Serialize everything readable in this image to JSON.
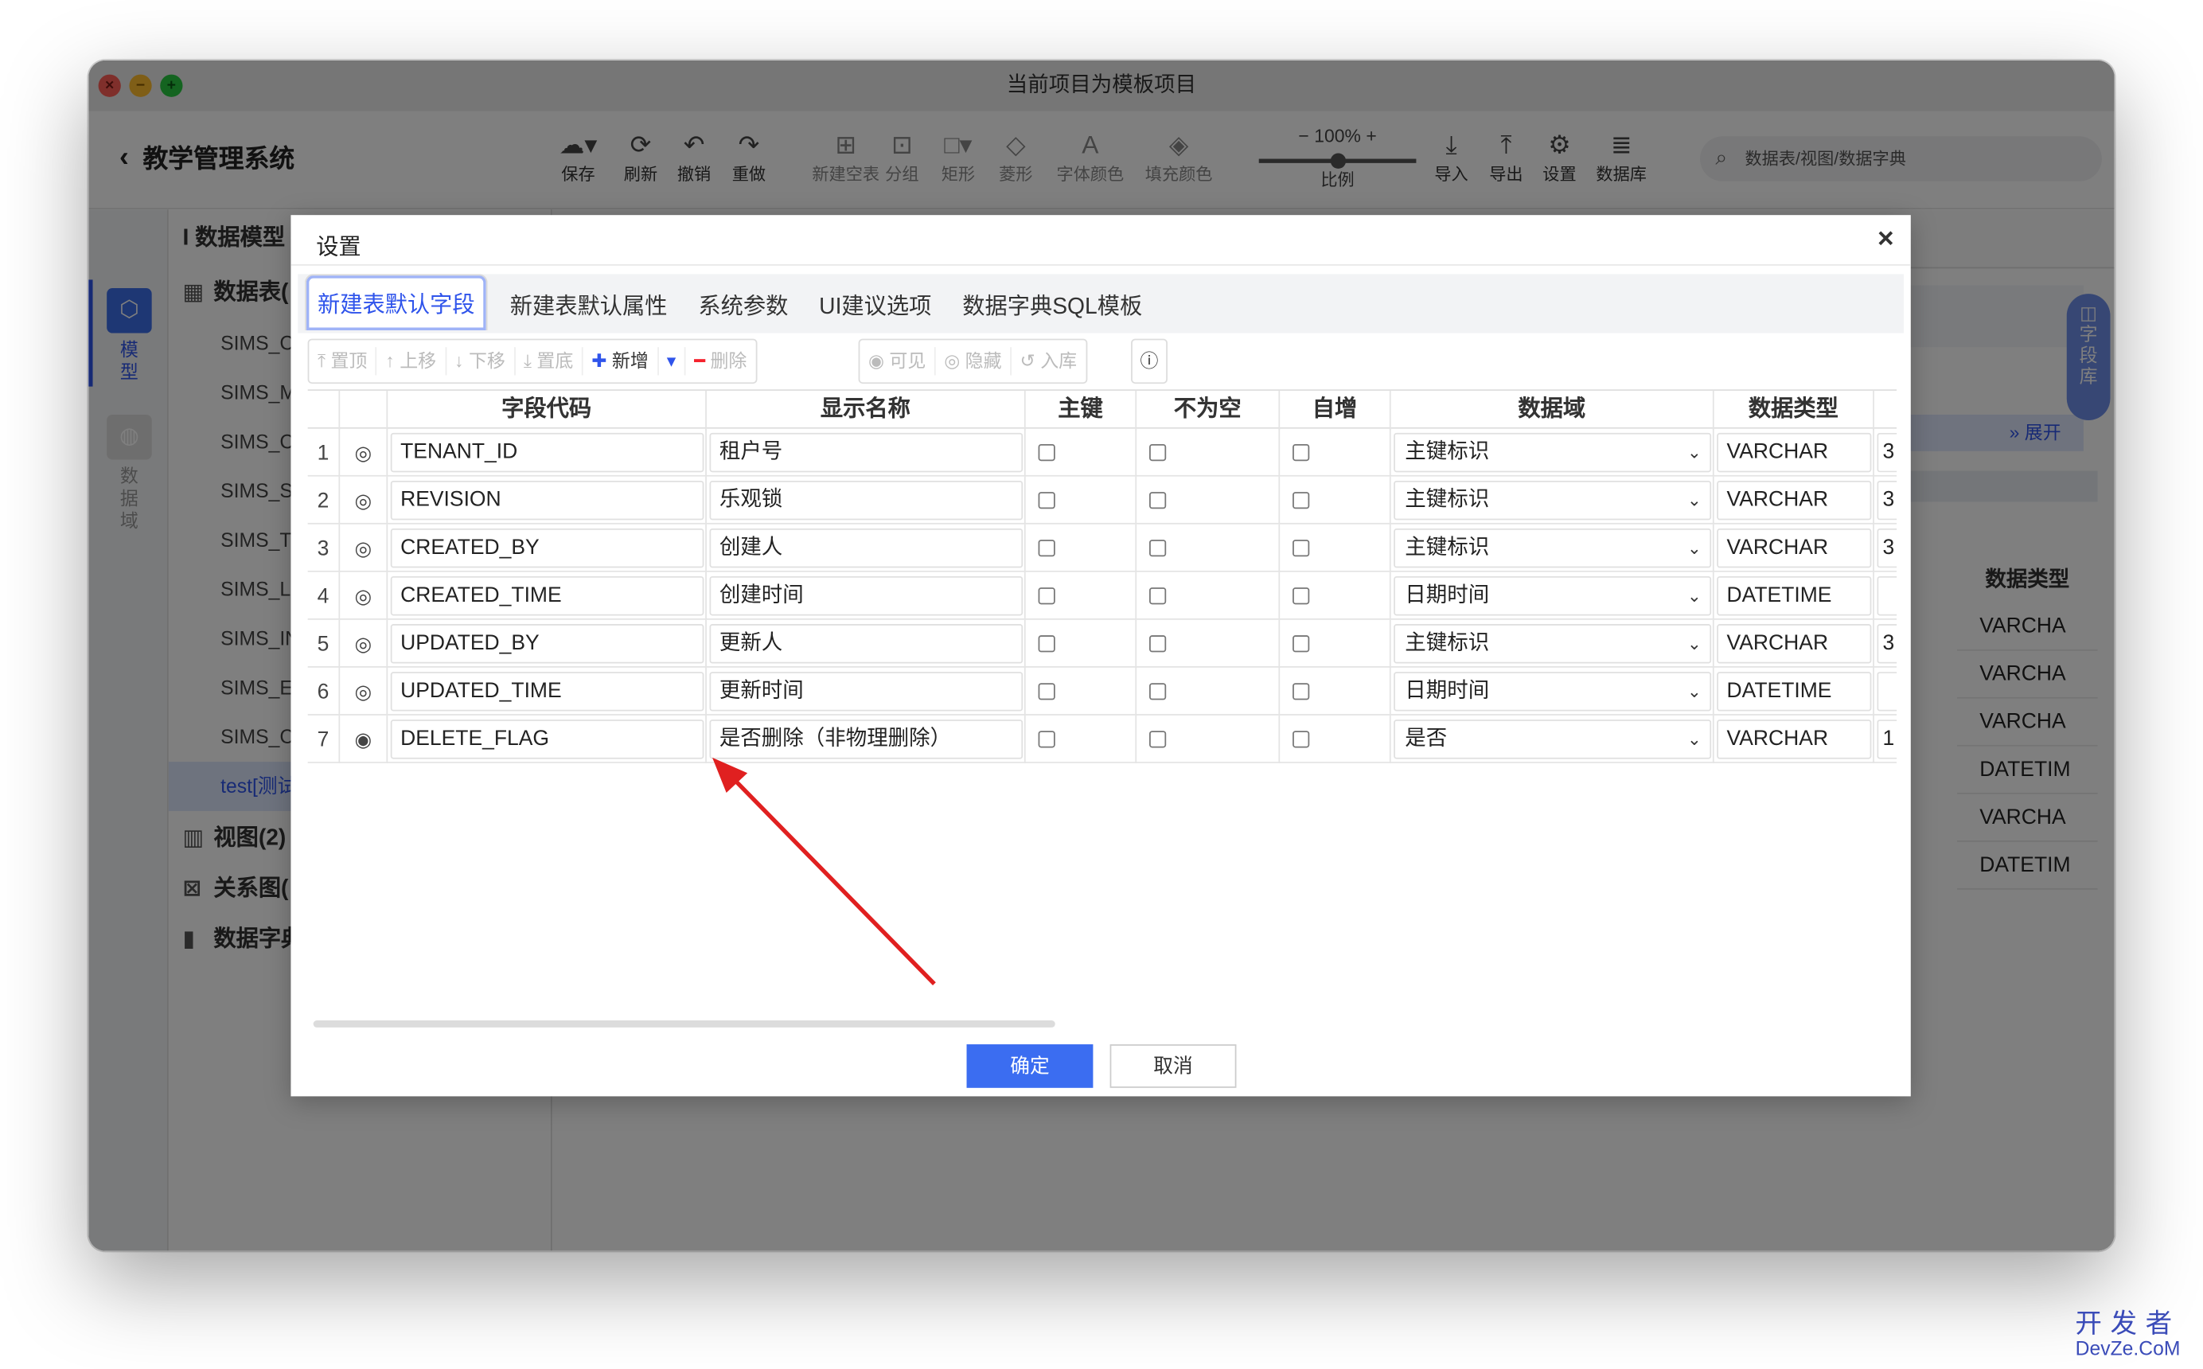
{
  "window": {
    "title": "当前项目为模板项目"
  },
  "app": {
    "back_title": "教学管理系统"
  },
  "toolbar": [
    {
      "label": "保存",
      "icon": "cloud-upload-icon",
      "state": "enabled"
    },
    {
      "label": "刷新",
      "icon": "refresh-icon",
      "state": "enabled"
    },
    {
      "label": "撤销",
      "icon": "undo-icon",
      "state": "enabled"
    },
    {
      "label": "重做",
      "icon": "redo-icon",
      "state": "enabled"
    },
    {
      "label": "新建空表",
      "icon": "new-table-icon",
      "state": "disabled"
    },
    {
      "label": "分组",
      "icon": "group-icon",
      "state": "disabled"
    },
    {
      "label": "矩形",
      "icon": "rectangle-icon",
      "state": "disabled"
    },
    {
      "label": "菱形",
      "icon": "diamond-icon",
      "state": "disabled"
    },
    {
      "label": "字体颜色",
      "icon": "font-color-icon",
      "state": "disabled"
    },
    {
      "label": "填充颜色",
      "icon": "fill-color-icon",
      "state": "disabled"
    },
    {
      "label": "导入",
      "icon": "import-icon",
      "state": "enabled"
    },
    {
      "label": "导出",
      "icon": "export-icon",
      "state": "enabled"
    },
    {
      "label": "设置",
      "icon": "gear-icon",
      "state": "enabled"
    },
    {
      "label": "数据库",
      "icon": "database-icon",
      "state": "enabled"
    }
  ],
  "zoom": {
    "value": "100%",
    "label": "比例",
    "minus": "−",
    "plus": "+"
  },
  "search": {
    "placeholder": "数据表/视图/数据字典"
  },
  "rail": [
    {
      "label": "模型",
      "icon": "cube-icon",
      "active": true
    },
    {
      "label": "数据域",
      "icon": "domain-icon",
      "active": false
    }
  ],
  "tree": {
    "header": "数据模型",
    "tables_label": "数据表(",
    "items": [
      "SIMS_C",
      "SIMS_M",
      "SIMS_C",
      "SIMS_S",
      "SIMS_T",
      "SIMS_L",
      "SIMS_IN",
      "SIMS_E",
      "SIMS_C",
      "test[测试"
    ],
    "views_label": "视图(2)",
    "relations_label": "关系图(",
    "dict_label": "数据字典"
  },
  "background": {
    "expand": "展开",
    "field_lib": "字段库",
    "col_header": "数据类型",
    "col_values": [
      "VARCHA",
      "VARCHA",
      "VARCHA",
      "DATETIM",
      "VARCHA",
      "DATETIM"
    ]
  },
  "dialog": {
    "title": "设置",
    "close": "×",
    "tabs": [
      "新建表默认字段",
      "新建表默认属性",
      "系统参数",
      "UI建议选项",
      "数据字典SQL模板"
    ],
    "buttons_group1": [
      "置顶",
      "上移",
      "下移",
      "置底",
      "新增",
      "删除"
    ],
    "buttons_group2": [
      "可见",
      "隐藏",
      "入库"
    ],
    "info": "ⓘ",
    "columns": [
      "字段代码",
      "显示名称",
      "主键",
      "不为空",
      "自增",
      "数据域",
      "数据类型"
    ],
    "rows": [
      {
        "no": "1",
        "code": "TENANT_ID",
        "name": "租户号",
        "pk": false,
        "notnull": false,
        "auto": false,
        "domain": "主键标识",
        "type": "VARCHAR",
        "len": "3"
      },
      {
        "no": "2",
        "code": "REVISION",
        "name": "乐观锁",
        "pk": false,
        "notnull": false,
        "auto": false,
        "domain": "主键标识",
        "type": "VARCHAR",
        "len": "3"
      },
      {
        "no": "3",
        "code": "CREATED_BY",
        "name": "创建人",
        "pk": false,
        "notnull": false,
        "auto": false,
        "domain": "主键标识",
        "type": "VARCHAR",
        "len": "3"
      },
      {
        "no": "4",
        "code": "CREATED_TIME",
        "name": "创建时间",
        "pk": false,
        "notnull": false,
        "auto": false,
        "domain": "日期时间",
        "type": "DATETIME",
        "len": ""
      },
      {
        "no": "5",
        "code": "UPDATED_BY",
        "name": "更新人",
        "pk": false,
        "notnull": false,
        "auto": false,
        "domain": "主键标识",
        "type": "VARCHAR",
        "len": "3"
      },
      {
        "no": "6",
        "code": "UPDATED_TIME",
        "name": "更新时间",
        "pk": false,
        "notnull": false,
        "auto": false,
        "domain": "日期时间",
        "type": "DATETIME",
        "len": ""
      },
      {
        "no": "7",
        "code": "DELETE_FLAG",
        "name": "是否删除（非物理删除）",
        "pk": false,
        "notnull": false,
        "auto": false,
        "domain": "是否",
        "type": "VARCHAR",
        "len": "1"
      }
    ],
    "ok": "确定",
    "cancel": "取消"
  },
  "watermark": {
    "line1": "开发者",
    "line2": "DevZe.CoM"
  },
  "colors": {
    "accent": "#2f54eb",
    "primary_button": "#3b6df1",
    "arrow": "#e02020"
  }
}
